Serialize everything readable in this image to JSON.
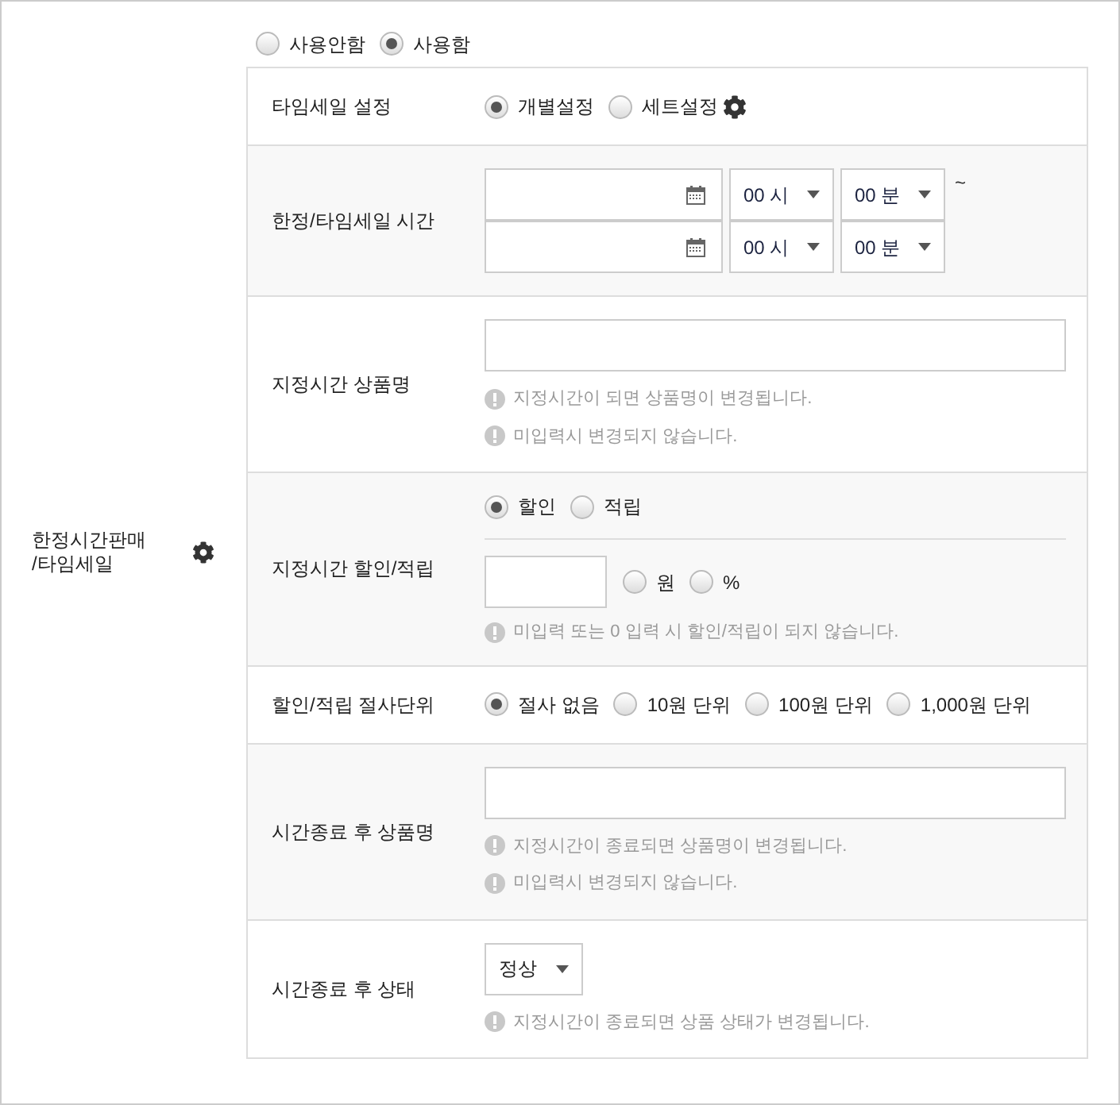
{
  "section": {
    "label": "한정시간판매\n/타임세일",
    "use_options": [
      {
        "label": "사용안함",
        "selected": false
      },
      {
        "label": "사용함",
        "selected": true
      }
    ]
  },
  "rows": [
    {
      "kind": "radios",
      "label": "타임세일 설정",
      "options": [
        {
          "label": "개별설정",
          "selected": true
        },
        {
          "label": "세트설정",
          "selected": false
        }
      ],
      "gear": true
    },
    {
      "kind": "time_range",
      "label": "한정/타임세일 시간",
      "lines": [
        {
          "hour": "00 시",
          "minute": "00 분",
          "separator": "~"
        },
        {
          "hour": "00 시",
          "minute": "00 분"
        }
      ]
    },
    {
      "kind": "text_notes",
      "label": "지정시간 상품명",
      "notes": [
        "지정시간이 되면 상품명이 변경됩니다.",
        "미입력시 변경되지 않습니다."
      ]
    },
    {
      "kind": "discount",
      "label": "지정시간 할인/적립",
      "type_options": [
        {
          "label": "할인",
          "selected": true
        },
        {
          "label": "적립",
          "selected": false
        }
      ],
      "unit_options": [
        {
          "label": "원",
          "selected": false
        },
        {
          "label": "%",
          "selected": false
        }
      ],
      "notes": [
        "미입력 또는 0 입력 시 할인/적립이 되지 않습니다."
      ]
    },
    {
      "kind": "radios",
      "label": "할인/적립 절사단위",
      "options": [
        {
          "label": "절사 없음",
          "selected": true
        },
        {
          "label": "10원 단위",
          "selected": false
        },
        {
          "label": "100원 단위",
          "selected": false
        },
        {
          "label": "1,000원 단위",
          "selected": false
        }
      ]
    },
    {
      "kind": "text_notes",
      "label": "시간종료 후 상품명",
      "notes": [
        "지정시간이 종료되면 상품명이 변경됩니다.",
        "미입력시 변경되지 않습니다."
      ]
    },
    {
      "kind": "select_notes",
      "label": "시간종료 후 상태",
      "value": "정상",
      "notes": [
        "지정시간이 종료되면 상품 상태가 변경됩니다."
      ]
    }
  ]
}
